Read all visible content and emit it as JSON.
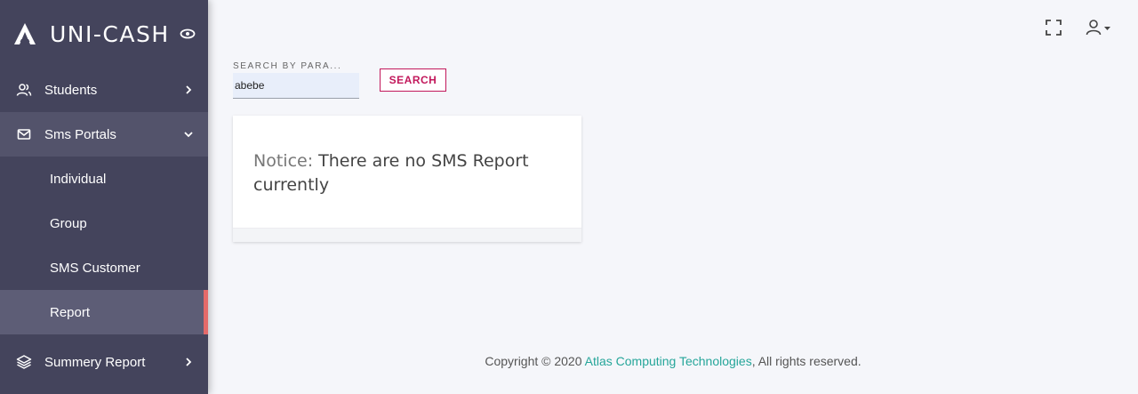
{
  "brand": {
    "name": "UNI-CASH"
  },
  "sidebar": {
    "items": [
      {
        "label": "Students",
        "icon": "users-icon"
      },
      {
        "label": "Sms Portals",
        "icon": "mail-icon"
      },
      {
        "label": "Summery Report",
        "icon": "layers-icon"
      }
    ],
    "sms_sub_items": [
      {
        "label": "Individual"
      },
      {
        "label": "Group"
      },
      {
        "label": "SMS Customer"
      },
      {
        "label": "Report"
      }
    ],
    "active_item": "Report"
  },
  "search": {
    "label": "SEARCH BY PARA...",
    "value": "abebe",
    "button_label": "SEARCH"
  },
  "notice": {
    "prefix": "Notice:",
    "message": " There are no SMS Report currently"
  },
  "footer": {
    "text_before": "Copyright © 2020 ",
    "link_text": "Atlas Computing Technologies",
    "text_after": ", All rights reserved."
  },
  "colors": {
    "sidebar_bg": "#44445c",
    "active_marker": "#e46a6a",
    "search_button": "#c2185b",
    "footer_link": "#26a69a"
  }
}
